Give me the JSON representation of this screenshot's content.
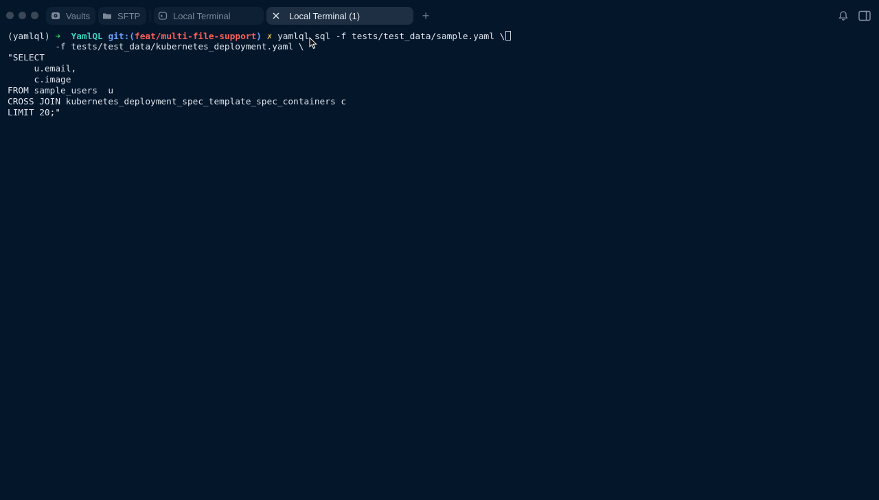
{
  "tabs": [
    {
      "label": "Vaults",
      "icon": "vault-icon"
    },
    {
      "label": "SFTP",
      "icon": "folder-icon"
    },
    {
      "label": "Local Terminal",
      "icon": "terminal-icon"
    },
    {
      "label": "Local Terminal (1)",
      "icon": "close-icon",
      "active": true
    }
  ],
  "new_tab_label": "+",
  "prompt": {
    "env": "(yamlql)",
    "arrow": "➜",
    "dir": "YamlQL",
    "git_prefix": "git:(",
    "branch": "feat/multi-file-support",
    "git_suffix": ")",
    "dirty": "✗",
    "command": "yamlql sql -f tests/test_data/sample.yaml \\"
  },
  "terminal_lines": [
    "         -f tests/test_data/kubernetes_deployment.yaml \\",
    "\"SELECT",
    "     u.email,",
    "     c.image",
    "FROM sample_users  u",
    "CROSS JOIN kubernetes_deployment_spec_template_spec_containers c",
    "LIMIT 20;\""
  ],
  "colors": {
    "background": "#04162a",
    "active_tab": "#1f2f43",
    "prompt_arrow": "#2ecc71",
    "prompt_dir": "#39d3be",
    "git": "#6aa0ff",
    "branch": "#ff5f56",
    "dirty": "#e6c35c"
  }
}
